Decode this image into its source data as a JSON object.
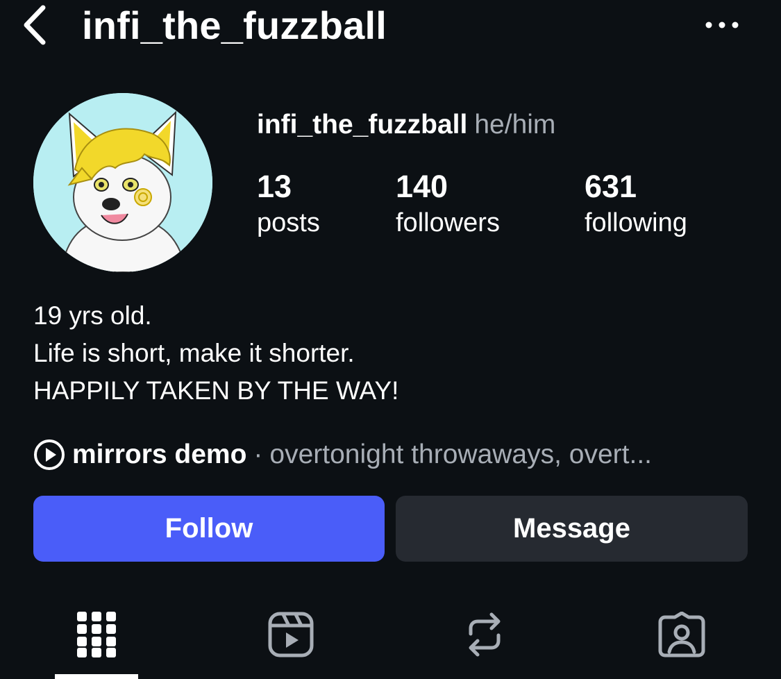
{
  "header": {
    "back_icon": "chevron-left-icon",
    "title": "infi_the_fuzzball",
    "more_icon": "ellipsis-icon"
  },
  "profile": {
    "avatar_description": "cartoon-white-fox-avatar",
    "username": "infi_the_fuzzball",
    "pronouns": "he/him"
  },
  "stats": [
    {
      "value": "13",
      "label": "posts"
    },
    {
      "value": "140",
      "label": "followers"
    },
    {
      "value": "631",
      "label": "following"
    }
  ],
  "bio": {
    "line1": "19 yrs old.",
    "line2": "Life is short, make it shorter.",
    "line3": "HAPPILY TAKEN BY THE WAY!"
  },
  "music": {
    "icon": "play-circle-icon",
    "track": "mirrors demo",
    "separator": "·",
    "album": "overtonight throwaways, overt..."
  },
  "actions": {
    "follow_label": "Follow",
    "message_label": "Message"
  },
  "tabs": [
    {
      "icon": "grid-icon",
      "selected": true
    },
    {
      "icon": "reels-icon",
      "selected": false
    },
    {
      "icon": "reposts-icon",
      "selected": false
    },
    {
      "icon": "tagged-icon",
      "selected": false
    }
  ],
  "colors": {
    "background": "#0c1014",
    "follow_button": "#4a5df9",
    "message_button": "#262a31",
    "secondary_text": "#a8aeb6"
  }
}
